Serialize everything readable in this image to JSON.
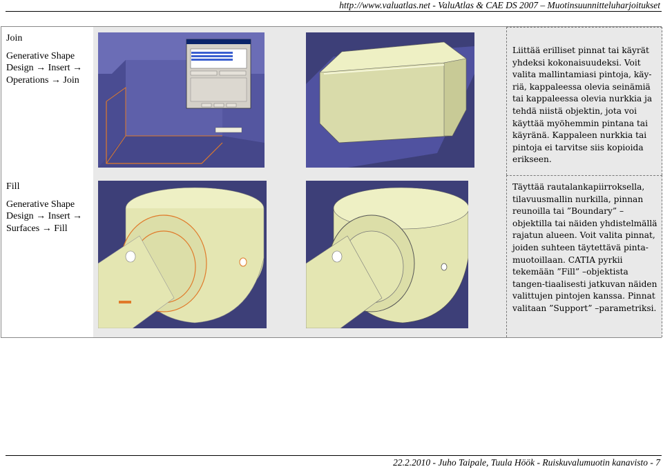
{
  "header": {
    "text": "http://www.valuatlas.net - ValuAtlas & CAE DS 2007 – Muotinsuunnitteluharjoitukset"
  },
  "rows": [
    {
      "title": "Join",
      "path": "Generative Shape Design → Insert → Operations → Join",
      "description": "Liittää erilliset pinnat tai käyrät yhdeksi kokonaisuudeksi. Voit valita mallintamiasi pintoja, käy-riä, kappaleessa olevia seinämiä tai kappaleessa olevia nurkkia ja tehdä niistä objektin, jota voi käyttää myöhemmin pintana tai käyränä. Kappaleen nurkkia tai pintoja ei tarvitse siis kopioida erikseen."
    },
    {
      "title": "Fill",
      "path": "Generative Shape Design → Insert → Surfaces → Fill",
      "description": "Täyttää rautalankapiirroksella, tilavuusmallin nurkilla, pinnan reunoilla tai ”Boundary” –objektilla tai näiden yhdistelmällä rajatun alueen. Voit valita pinnat, joiden suhteen täytettävä pinta-muotoillaan. CATIA pyrkii tekemään ”Fill” –objektista tangen-tiaalisesti jatkuvan näiden valittujen pintojen kanssa. Pinnat valitaan ”Support” –parametriksi."
    }
  ],
  "footer": {
    "text": "22.2.2010 - Juho Taipale, Tuula Höök - Ruiskuvalumuotin kanavisto - 7"
  },
  "colors": {
    "cad_background": "#3d3f78",
    "part_surface": "#e4e6b2",
    "selection": "#e07a2a",
    "cell_background": "#e9e9e9"
  }
}
